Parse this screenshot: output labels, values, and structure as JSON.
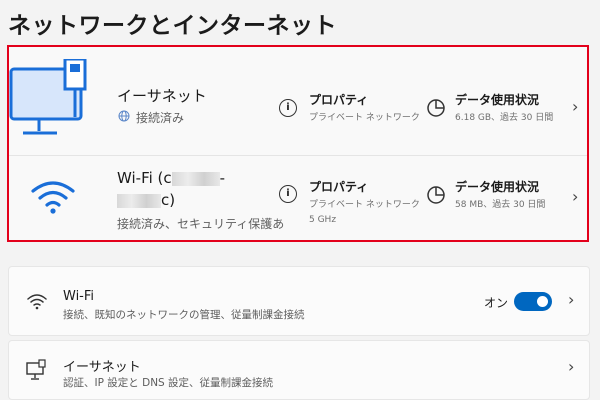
{
  "page": {
    "title": "ネットワークとインターネット"
  },
  "ethernet_status": {
    "name": "イーサネット",
    "status": "接続済み",
    "properties_label": "プロパティ",
    "properties_sub": "プライベート ネットワーク",
    "usage_label": "データ使用状況",
    "usage_sub": "6.18 GB、過去 30 日間"
  },
  "wifi_status": {
    "name_prefix": "Wi-Fi (c",
    "name_suffix": "c)",
    "status": "接続済み、セキュリティ保護あ",
    "properties_label": "プロパティ",
    "properties_sub_line1": "プライベート ネットワーク",
    "properties_sub_line2": "5 GHz",
    "usage_label": "データ使用状況",
    "usage_sub": "58 MB、過去 30 日間"
  },
  "wifi_card": {
    "title": "Wi-Fi",
    "subtitle": "接続、既知のネットワークの管理、従量制課金接続",
    "toggle_label": "オン",
    "toggle_on": true
  },
  "ethernet_card": {
    "title": "イーサネット",
    "subtitle": "認証、IP 設定と DNS 設定、従量制課金接続"
  },
  "colors": {
    "accent": "#0067c0",
    "highlight_border": "#e3001b",
    "icon_blue": "#1a6ed8"
  },
  "icons": {
    "monitor": "ethernet-monitor-icon",
    "globe": "globe-icon",
    "info": "info-icon",
    "usage": "pie-chart-icon",
    "chevron": "chevron-right-icon",
    "wifi": "wifi-icon",
    "ethernet": "ethernet-icon"
  }
}
